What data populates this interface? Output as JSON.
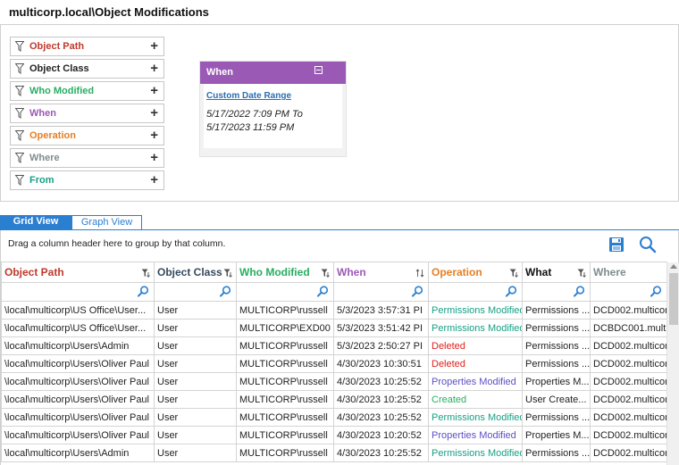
{
  "window": {
    "title": "multicorp.local\\Object Modifications"
  },
  "filters": [
    {
      "label": "Object Path",
      "color": "#c0392b"
    },
    {
      "label": "Object Class",
      "color": "#222222"
    },
    {
      "label": "Who Modified",
      "color": "#27ae60"
    },
    {
      "label": "When",
      "color": "#9b59b6"
    },
    {
      "label": "Operation",
      "color": "#e67e22"
    },
    {
      "label": "Where",
      "color": "#7f8c8d"
    },
    {
      "label": "From",
      "color": "#16a085"
    }
  ],
  "when_card": {
    "title": "When",
    "link": "Custom Date Range",
    "range": "5/17/2022 7:09 PM To 5/17/2023 11:59 PM",
    "accent": "#9b59b6"
  },
  "tabs": {
    "grid": "Grid View",
    "graph": "Graph View"
  },
  "grid": {
    "group_hint": "Drag a column header here to group by that column.",
    "columns": [
      {
        "label": "Object Path",
        "color": "#c0392b",
        "icon": "filter-icon"
      },
      {
        "label": "Object Class",
        "color": "#34495e",
        "icon": "filter-icon"
      },
      {
        "label": "Who Modified",
        "color": "#27ae60",
        "icon": "filter-icon"
      },
      {
        "label": "When",
        "color": "#9b59b6",
        "icon": "sort-icon"
      },
      {
        "label": "Operation",
        "color": "#e67e22",
        "icon": "filter-icon"
      },
      {
        "label": "What",
        "color": "#111111",
        "icon": "filter-icon"
      },
      {
        "label": "Where",
        "color": "#7f8c8d",
        "icon": ""
      }
    ],
    "op_colors": {
      "Permissions Modified": "#16a085",
      "Deleted": "#e0201b",
      "Properties Modified": "#5b4fc7",
      "Created": "#27ae60"
    },
    "rows": [
      [
        "\\local\\multicorp\\US Office\\User...",
        "User",
        "MULTICORP\\russell",
        "5/3/2023 3:57:31 PI",
        "Permissions Modified",
        "Permissions ...",
        "DCD002.multicor"
      ],
      [
        "\\local\\multicorp\\US Office\\User...",
        "User",
        "MULTICORP\\EXD00",
        "5/3/2023 3:51:42 PI",
        "Permissions Modified",
        "Permissions ...",
        "DCBDC001.multic"
      ],
      [
        "\\local\\multicorp\\Users\\Admin",
        "User",
        "MULTICORP\\russell",
        "5/3/2023 2:50:27 PI",
        "Deleted",
        "Permissions ...",
        "DCD002.multicor"
      ],
      [
        "\\local\\multicorp\\Users\\Oliver Paul",
        "User",
        "MULTICORP\\russell",
        "4/30/2023 10:30:51",
        "Deleted",
        "Permissions ...",
        "DCD002.multicor"
      ],
      [
        "\\local\\multicorp\\Users\\Oliver Paul",
        "User",
        "MULTICORP\\russell",
        "4/30/2023 10:25:52",
        "Properties Modified",
        "Properties M...",
        "DCD002.multicor"
      ],
      [
        "\\local\\multicorp\\Users\\Oliver Paul",
        "User",
        "MULTICORP\\russell",
        "4/30/2023 10:25:52",
        "Created",
        "User Create...",
        "DCD002.multicor"
      ],
      [
        "\\local\\multicorp\\Users\\Oliver Paul",
        "User",
        "MULTICORP\\russell",
        "4/30/2023 10:25:52",
        "Permissions Modified",
        "Permissions ...",
        "DCD002.multicor"
      ],
      [
        "\\local\\multicorp\\Users\\Oliver Paul",
        "User",
        "MULTICORP\\russell",
        "4/30/2023 10:20:52",
        "Properties Modified",
        "Properties M...",
        "DCD002.multicor"
      ],
      [
        "\\local\\multicorp\\Users\\Admin",
        "User",
        "MULTICORP\\russell",
        "4/30/2023 10:25:52",
        "Permissions Modified",
        "Permissions ...",
        "DCD002.multicor"
      ]
    ]
  }
}
